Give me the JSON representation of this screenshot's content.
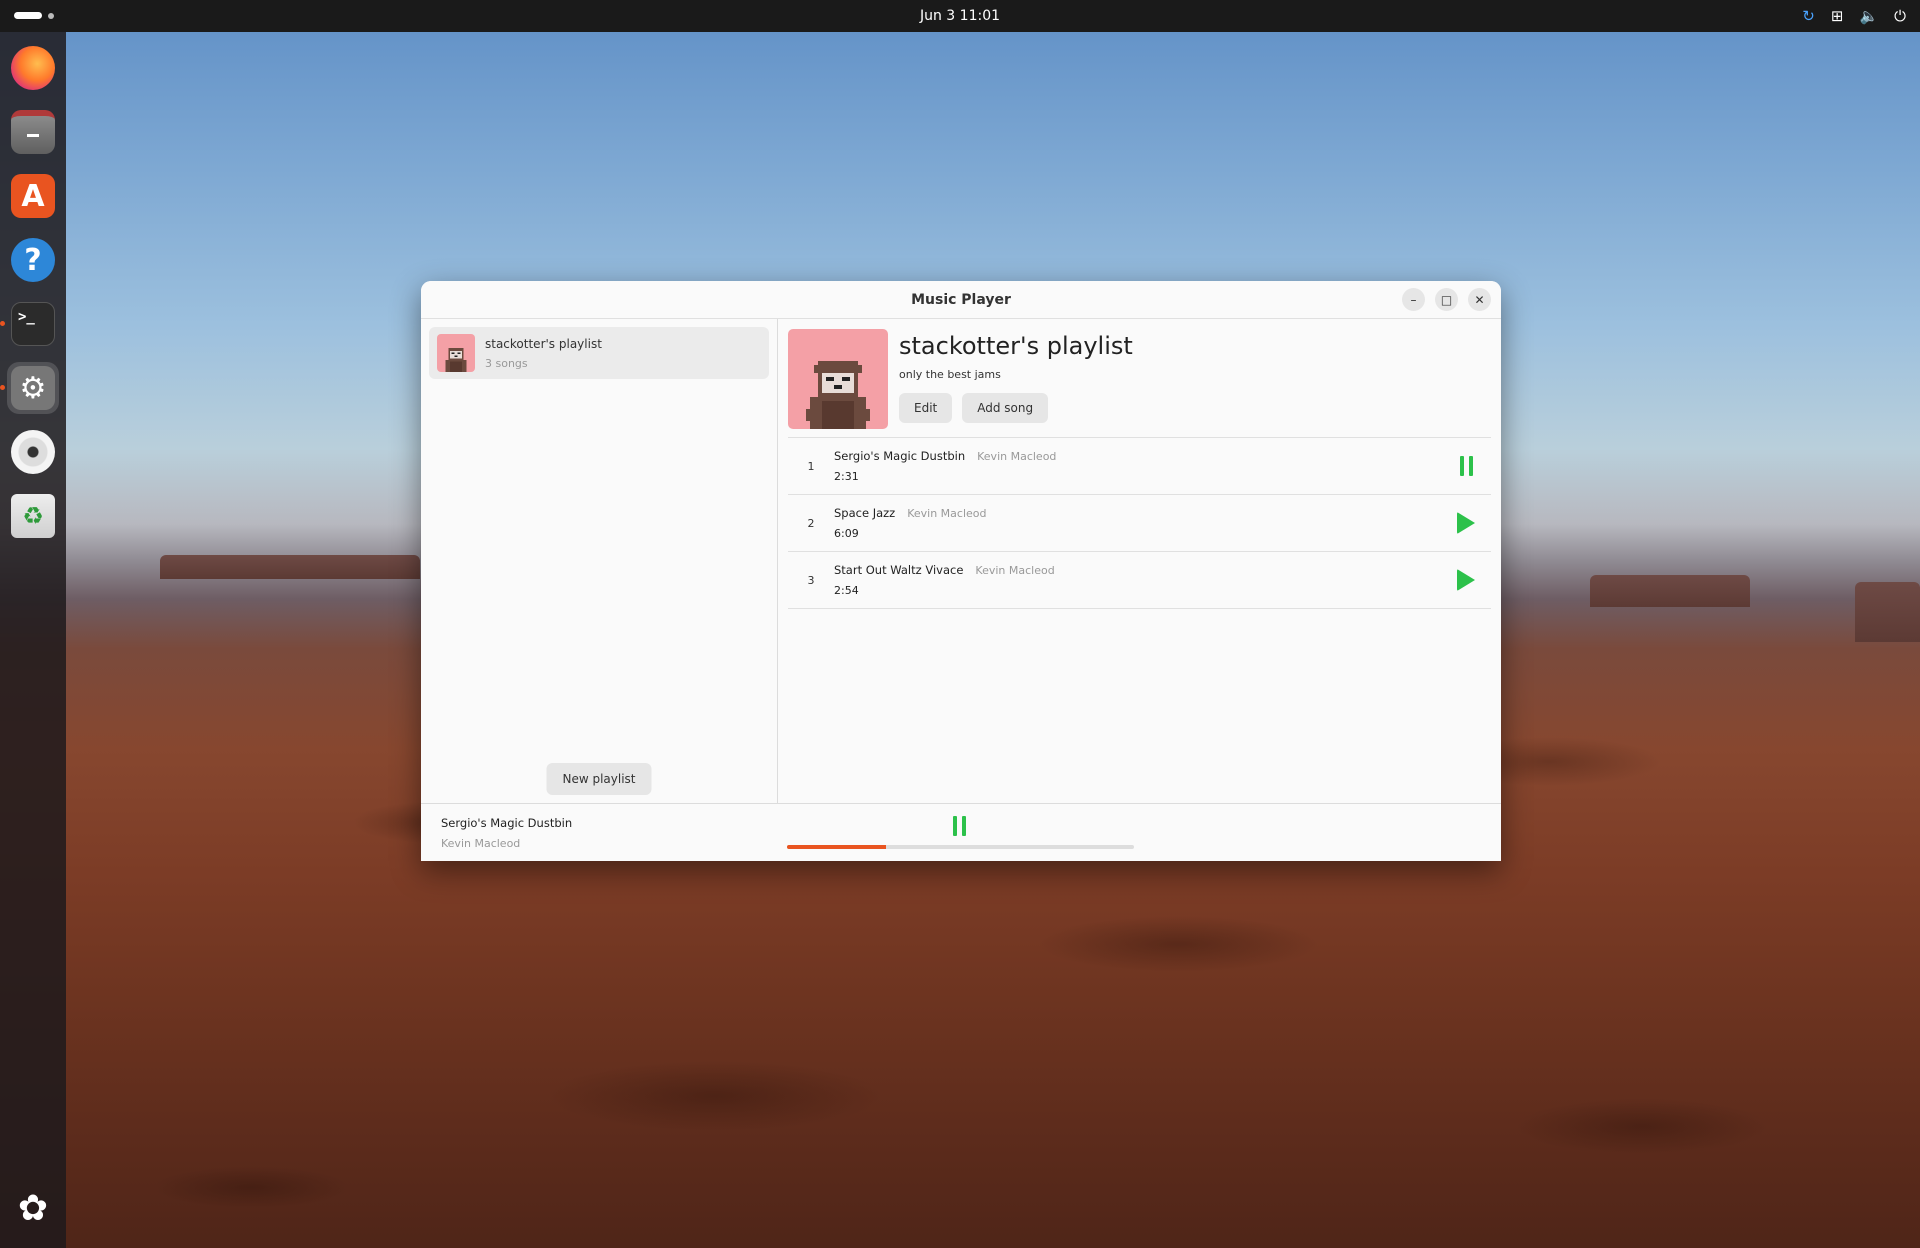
{
  "topbar": {
    "datetime": "Jun 3  11:01",
    "tray_icons": [
      "sync-icon",
      "network-icon",
      "volume-icon",
      "power-icon"
    ]
  },
  "dock": {
    "items": [
      "firefox-icon",
      "files-icon",
      "app-center-icon",
      "help-icon",
      "terminal-icon",
      "settings-icon",
      "disc-icon",
      "trash-icon"
    ],
    "bottom": "ubuntu-apps-icon"
  },
  "window": {
    "title": "Music Player"
  },
  "sidebar": {
    "playlists": [
      {
        "name": "stackotter's playlist",
        "count": "3 songs"
      }
    ],
    "new_playlist_label": "New playlist"
  },
  "playlist": {
    "title": "stackotter's playlist",
    "description": "only the best jams",
    "edit_label": "Edit",
    "add_song_label": "Add song",
    "songs": [
      {
        "num": "1",
        "title": "Sergio's Magic Dustbin",
        "artist": "Kevin Macleod",
        "duration": "2:31",
        "state": "pause"
      },
      {
        "num": "2",
        "title": "Space Jazz",
        "artist": "Kevin Macleod",
        "duration": "6:09",
        "state": "play"
      },
      {
        "num": "3",
        "title": "Start Out Waltz Vivace",
        "artist": "Kevin Macleod",
        "duration": "2:54",
        "state": "play"
      }
    ]
  },
  "now_playing": {
    "title": "Sergio's Magic Dustbin",
    "artist": "Kevin Macleod",
    "progress": 0.285
  },
  "colors": {
    "accent_green": "#2cc14a",
    "progress_orange": "#e95420",
    "cover_pink": "#f4a0a6"
  }
}
